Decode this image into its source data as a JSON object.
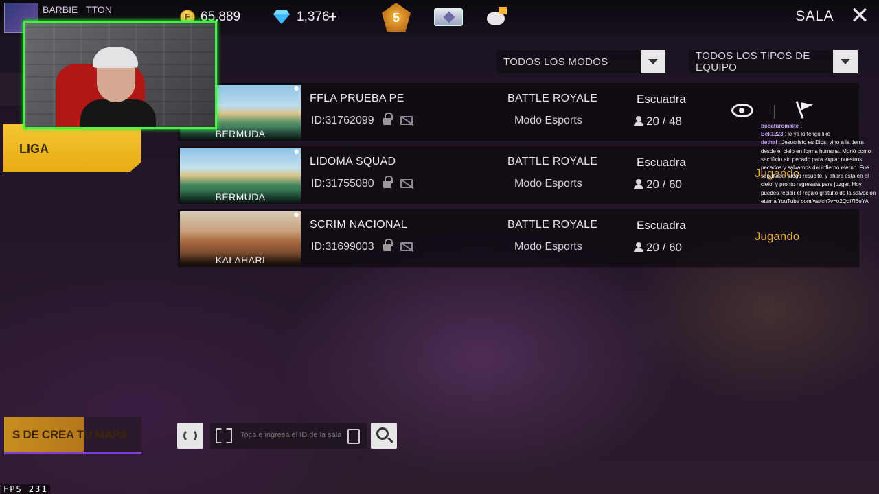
{
  "player": {
    "name": "BARBIE",
    "name2": "TTON"
  },
  "currency": {
    "gold": "65,889",
    "diamonds": "1,376",
    "diamond_add": "+"
  },
  "badge": {
    "level": "5"
  },
  "header": {
    "title": "SALA",
    "close": "✕"
  },
  "filters": {
    "modes": "TODOS LOS MODOS",
    "team_types": "TODOS LOS TIPOS DE EQUIPO"
  },
  "rooms": [
    {
      "name": "FFLA PRUEBA PE",
      "id": "ID:31762099",
      "map": "BERMUDA",
      "mode": "BATTLE ROYALE",
      "sub_mode": "Modo Esports",
      "team": "Escuadra",
      "players": "20 / 48",
      "status": ""
    },
    {
      "name": "LIDOMA SQUAD",
      "id": "ID:31755080",
      "map": "BERMUDA",
      "mode": "BATTLE ROYALE",
      "sub_mode": "Modo Esports",
      "team": "Escuadra",
      "players": "20 / 60",
      "status": "Jugando"
    },
    {
      "name": "SCRIM NACIONAL",
      "id": "ID:31699003",
      "map": "KALAHARI",
      "mode": "BATTLE ROYALE",
      "sub_mode": "Modo Esports",
      "team": "Escuadra",
      "players": "20 / 60",
      "status": "Jugando"
    }
  ],
  "left_panel": {
    "liga": "LIGA"
  },
  "bottom": {
    "create_map": "S DE CREA TU MAPA",
    "id_placeholder": "Toca e ingresa el ID de la sala"
  },
  "fps": "FPS 231",
  "chat": [
    {
      "user": "bocaturomaite",
      "msg": ""
    },
    {
      "user": "Bek1223",
      "msg": "le ya lo tengo like"
    },
    {
      "user": "dethal",
      "msg": "Jesucristo es Dios, vino a la tierra desde el cielo en forma humana. Murió como sacrificio sin pecado para expiar nuestros pecados y salvarnos del infierno eterno. Fue sepultado, luego resucitó, y ahora está en el cielo, y pronto regresará para juzgar. Hoy puedes recibir el regalo gratuito de la salvación eterna YouTube com/watch?v=o2Qdi7I6oYA"
    }
  ]
}
